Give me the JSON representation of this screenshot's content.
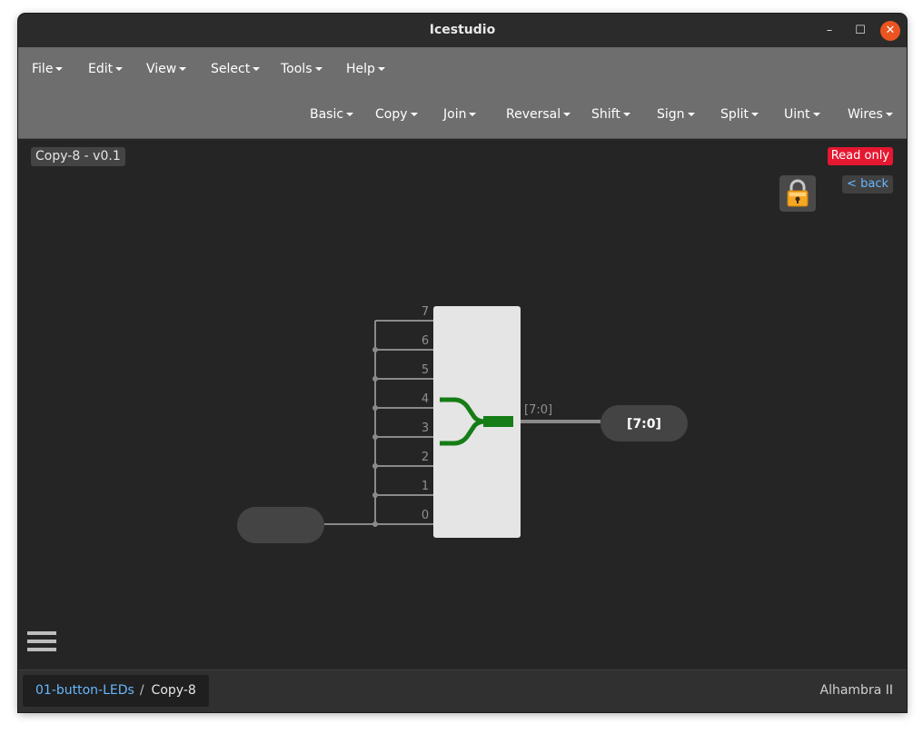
{
  "window": {
    "title": "Icestudio"
  },
  "window_controls": {
    "minimize": "–",
    "maximize": "☐",
    "close": "✕"
  },
  "menu": [
    {
      "label": "File"
    },
    {
      "label": "Edit"
    },
    {
      "label": "View"
    },
    {
      "label": "Select"
    },
    {
      "label": "Tools"
    },
    {
      "label": "Help"
    }
  ],
  "toolbar": [
    {
      "label": "Basic"
    },
    {
      "label": "Copy"
    },
    {
      "label": "Join"
    },
    {
      "label": "Reversal"
    },
    {
      "label": "Shift"
    },
    {
      "label": "Sign"
    },
    {
      "label": "Split"
    },
    {
      "label": "Uint"
    },
    {
      "label": "Wires"
    }
  ],
  "canvas": {
    "module_title": "Copy-8 - v0.1",
    "read_only": "Read only",
    "back": "< back",
    "lock_icon": "lock-icon",
    "diagram": {
      "input_port_labels": [
        "7",
        "6",
        "5",
        "4",
        "3",
        "2",
        "1",
        "0"
      ],
      "output_bus_label": "[7:0]",
      "output_port_name": "[7:0]",
      "input_port_name": "",
      "colors": {
        "block": "#e5e5e5",
        "wire": "#8a8a8a",
        "symbol": "#167c16",
        "port": "#444444"
      }
    }
  },
  "footer": {
    "breadcrumb": [
      {
        "label": "01-button-LEDs"
      },
      {
        "label": "Copy-8"
      }
    ],
    "breadcrumb_sep": "/",
    "board": "Alhambra II"
  },
  "colors": {
    "menubar": "#6e6e6e",
    "canvas": "#252525",
    "read_only": "#e51731",
    "link": "#67b7ff",
    "close_button": "#e95420"
  }
}
